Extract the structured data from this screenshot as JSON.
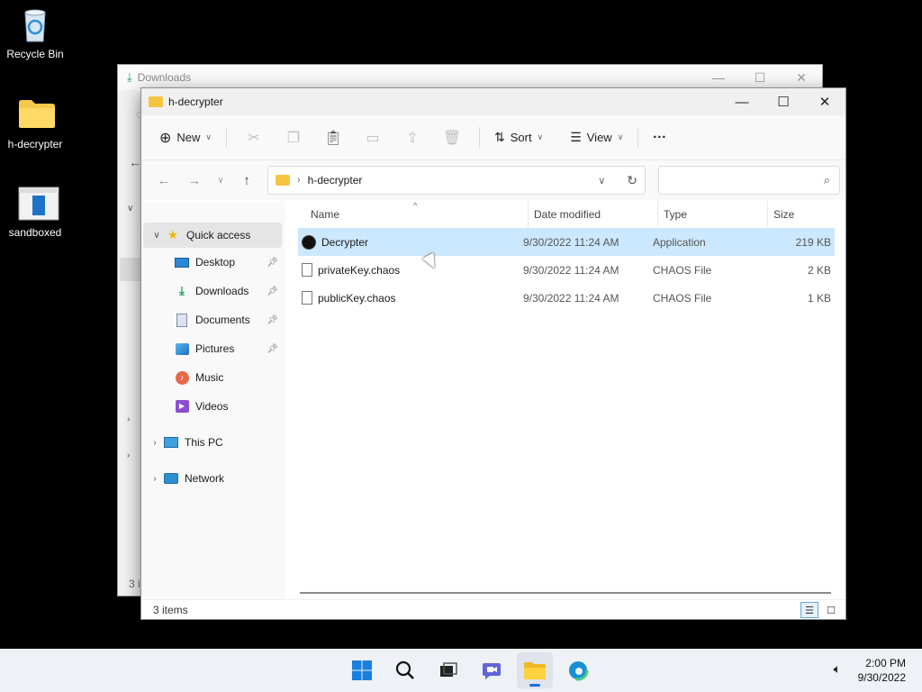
{
  "desktop": {
    "icons": [
      {
        "label": "Recycle Bin"
      },
      {
        "label": "h-decrypter"
      },
      {
        "label": "sandboxed"
      }
    ]
  },
  "back_window": {
    "title": "Downloads",
    "status": "3 i"
  },
  "window": {
    "title": "h-decrypter",
    "controls": {
      "minimize": "—",
      "maximize": "☐",
      "close": "✕"
    }
  },
  "toolbar": {
    "new_label": "New",
    "sort_label": "Sort",
    "view_label": "View",
    "more_label": "···"
  },
  "address": {
    "path": "h-decrypter",
    "search_placeholder": ""
  },
  "nav": {
    "quick_access": "Quick access",
    "items": [
      {
        "label": "Desktop",
        "icon": "desktop-icon",
        "pinned": true
      },
      {
        "label": "Downloads",
        "icon": "download-icon",
        "pinned": true
      },
      {
        "label": "Documents",
        "icon": "documents-icon",
        "pinned": true
      },
      {
        "label": "Pictures",
        "icon": "pictures-icon",
        "pinned": true
      },
      {
        "label": "Music",
        "icon": "music-icon",
        "pinned": false
      },
      {
        "label": "Videos",
        "icon": "videos-icon",
        "pinned": false
      }
    ],
    "this_pc": "This PC",
    "network": "Network"
  },
  "columns": {
    "name": "Name",
    "date": "Date modified",
    "type": "Type",
    "size": "Size"
  },
  "files": [
    {
      "name": "Decrypter",
      "date": "9/30/2022 11:24 AM",
      "type": "Application",
      "size": "219 KB",
      "selected": true
    },
    {
      "name": "privateKey.chaos",
      "date": "9/30/2022 11:24 AM",
      "type": "CHAOS File",
      "size": "2 KB",
      "selected": false
    },
    {
      "name": "publicKey.chaos",
      "date": "9/30/2022 11:24 AM",
      "type": "CHAOS File",
      "size": "1 KB",
      "selected": false
    }
  ],
  "status": {
    "item_count": "3 items"
  },
  "taskbar": {
    "time": "2:00 PM",
    "date": "9/30/2022"
  },
  "colors": {
    "selection": "#cce8ff",
    "folder": "#f5c542",
    "accent": "#1a6fd8"
  }
}
